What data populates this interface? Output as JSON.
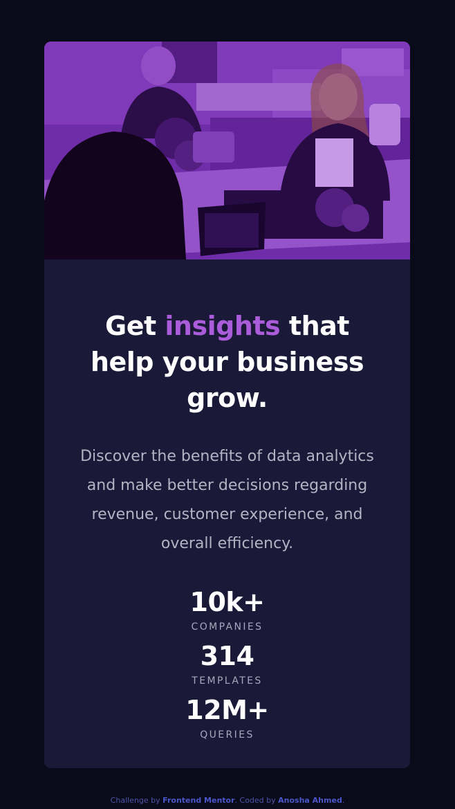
{
  "colors": {
    "background": "#090b1a",
    "card": "#1b1938",
    "accent": "#aa5cdb",
    "heading": "#ffffff",
    "body_text": "#b4b3c4",
    "stat_label": "#a8a7bb",
    "attribution_link": "#4c57c9"
  },
  "hero": {
    "image_name": "office-team-photo"
  },
  "headline": {
    "before": "Get ",
    "accent": "insights",
    "after": " that help your business grow."
  },
  "description": "Discover the benefits of data analytics and make better decisions regarding revenue, customer experience, and overall efficiency.",
  "stats": [
    {
      "value": "10k+",
      "label": "COMPANIES"
    },
    {
      "value": "314",
      "label": "TEMPLATES"
    },
    {
      "value": "12M+",
      "label": "QUERIES"
    }
  ],
  "attribution": {
    "prefix": "Challenge by ",
    "link1": "Frontend Mentor",
    "middle": ". Coded by ",
    "link2": "Anosha Ahmed",
    "suffix": "."
  }
}
